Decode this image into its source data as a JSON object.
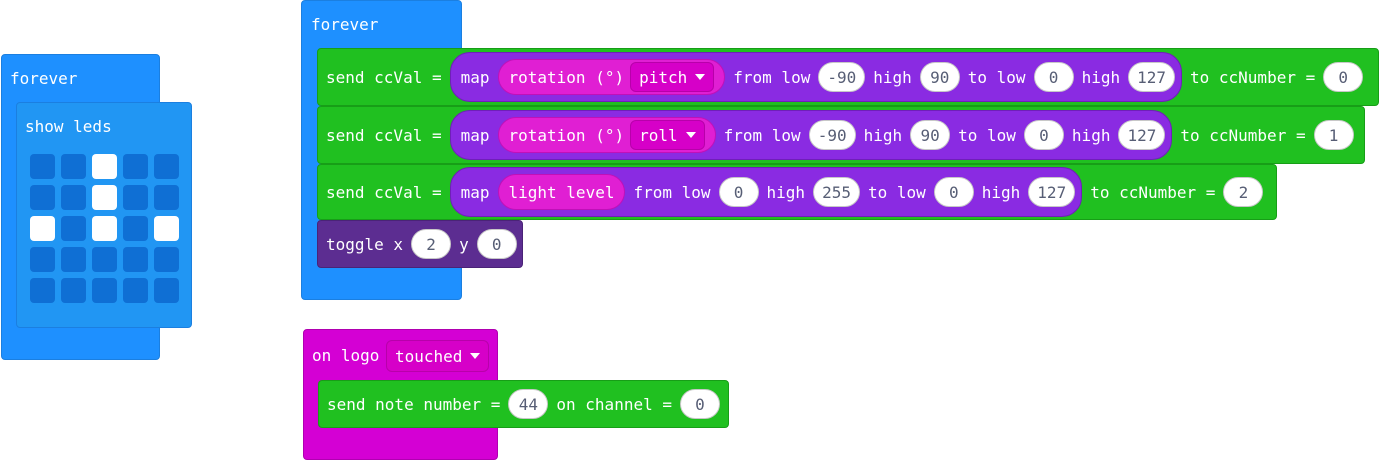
{
  "forever_left": {
    "label": "forever",
    "show_leds": {
      "label": "show leds",
      "grid": [
        [
          0,
          0,
          1,
          0,
          0
        ],
        [
          0,
          0,
          1,
          0,
          0
        ],
        [
          1,
          0,
          1,
          0,
          1
        ],
        [
          0,
          0,
          0,
          0,
          0
        ],
        [
          0,
          0,
          0,
          0,
          0
        ]
      ]
    }
  },
  "forever_right": {
    "label": "forever",
    "rows": [
      {
        "send_label": "send ccVal =",
        "map_label": "map",
        "sensor_label": "rotation (°)",
        "sensor_option": "pitch",
        "from_low_label": "from low",
        "from_low": "-90",
        "high1_label": "high",
        "from_high": "90",
        "to_low_label": "to low",
        "to_low": "0",
        "high2_label": "high",
        "to_high": "127",
        "cc_label": "to ccNumber =",
        "cc": "0"
      },
      {
        "send_label": "send ccVal =",
        "map_label": "map",
        "sensor_label": "rotation (°)",
        "sensor_option": "roll",
        "from_low_label": "from low",
        "from_low": "-90",
        "high1_label": "high",
        "from_high": "90",
        "to_low_label": "to low",
        "to_low": "0",
        "high2_label": "high",
        "to_high": "127",
        "cc_label": "to ccNumber =",
        "cc": "1"
      },
      {
        "send_label": "send ccVal =",
        "map_label": "map",
        "sensor_label": "light level",
        "from_low_label": "from low",
        "from_low": "0",
        "high1_label": "high",
        "from_high": "255",
        "to_low_label": "to low",
        "to_low": "0",
        "high2_label": "high",
        "to_high": "127",
        "cc_label": "to ccNumber =",
        "cc": "2"
      }
    ],
    "toggle": {
      "label": "toggle x",
      "x": "2",
      "y_label": "y",
      "y": "0"
    }
  },
  "on_logo": {
    "label": "on logo",
    "option": "touched",
    "send_note": {
      "label": "send note number =",
      "note": "44",
      "channel_label": "on channel =",
      "channel": "0"
    }
  }
}
